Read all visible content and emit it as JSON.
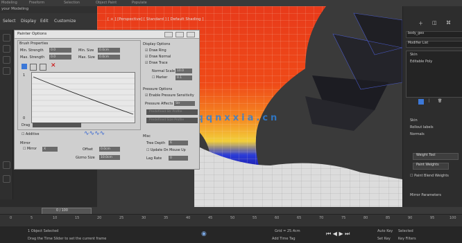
{
  "topbar": {
    "items": [
      "Modeling",
      "Freeform",
      "Selection",
      "Object Paint",
      "Populate"
    ]
  },
  "workspace_label": "your Modeling",
  "menu": {
    "items": [
      "Select",
      "Display",
      "Edit",
      "Customize"
    ]
  },
  "viewport": {
    "title": "[ + ] [Perspective] [ Standard ] [ Default Shading ]"
  },
  "dialog": {
    "title": "Painter Options",
    "brush_props": {
      "label": "Brush Properties",
      "min_strength_label": "Min. Strength",
      "min_strength": "0.0",
      "max_strength_label": "Max. Strength",
      "max_strength": "0.0",
      "min_size_label": "Min. Size",
      "min_size": "0.0cm",
      "max_size_label": "Max. Size",
      "max_size": "0.0cm"
    },
    "graph": {
      "axis_top": "1",
      "axis_bottom": "0"
    },
    "display": {
      "label": "Display Options",
      "draw_ring": "Draw Ring",
      "draw_normal": "Draw Normal",
      "draw_trace": "Draw Trace",
      "normal_scale_label": "Normal Scale",
      "normal_scale": "10.0",
      "marker_label": "Marker",
      "marker": "0.1"
    },
    "pressure": {
      "label": "Pressure Options",
      "enable": "Enable Pressure Sensitivity",
      "affects_label": "Pressure Affects",
      "affects_value": "Str"
    },
    "predefined_profile": "Predefined Str Profile",
    "predefined_size": "Predefined Size Profile",
    "drag_label": "Drag",
    "additive": "Additive",
    "mirror_label": "Mirror",
    "mirror_chk": "Mirror",
    "mirror_axis": "X",
    "offset_label": "Offset",
    "offset": "0.0cm",
    "gizmo_label": "Gizmo Size",
    "gizmo": "10.0cm",
    "misc_label": "Misc",
    "tree_depth_label": "Tree Depth",
    "tree_depth": "6",
    "update_label": "Update On Mouse Up",
    "lag_label": "Lag Rate",
    "lag": "0"
  },
  "watermark": "ZZX www.qqnxxia.cn",
  "right_panel": {
    "object_name": "body_geo",
    "modifier_list": "Modifier List",
    "stack": [
      "Skin",
      "Editable Poly"
    ],
    "skin_label": "Skin",
    "params": [
      "Skin",
      "Rollout labels",
      "Normals"
    ],
    "weight_tool": "Weight Tool",
    "paint_weights": "Paint Weights",
    "paint_blend": "Paint Blend Weights",
    "mirror_params": "Mirror Parameters"
  },
  "timeslider": {
    "label": "0 / 100"
  },
  "ticks": [
    "0",
    "5",
    "10",
    "15",
    "20",
    "25",
    "30",
    "35",
    "40",
    "45",
    "50",
    "55",
    "60",
    "65",
    "70",
    "75",
    "80",
    "85",
    "90",
    "95",
    "100"
  ],
  "status": {
    "selected": "1 Object Selected",
    "hint": "Drag the Time Slider to set the current frame",
    "grid": "Grid = 25.4cm",
    "add_tag": "Add Time Tag",
    "autokey": "Auto Key",
    "setkey": "Set Key",
    "selected_dd": "Selected",
    "filters": "Key Filters"
  },
  "colors": {
    "accent": "#2e7fd8",
    "dialog_bg": "#cfcfcf",
    "viewport_bg": "#3a3a3a"
  }
}
